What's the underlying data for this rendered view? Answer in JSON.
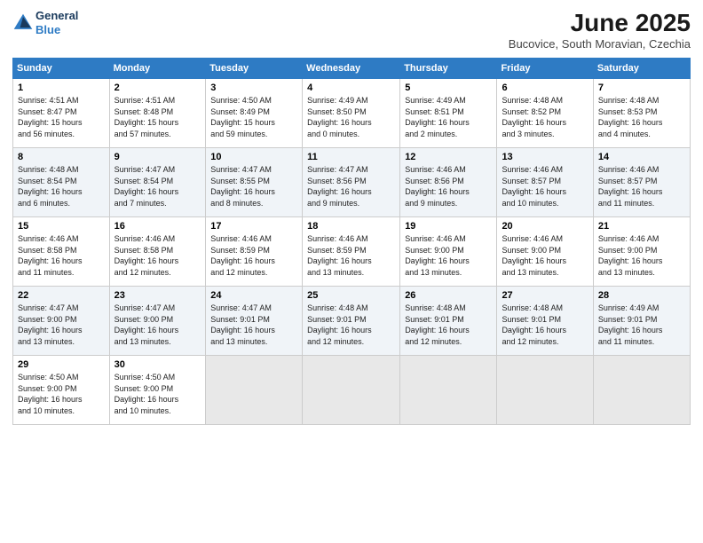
{
  "header": {
    "logo_line1": "General",
    "logo_line2": "Blue",
    "month_title": "June 2025",
    "location": "Bucovice, South Moravian, Czechia"
  },
  "weekdays": [
    "Sunday",
    "Monday",
    "Tuesday",
    "Wednesday",
    "Thursday",
    "Friday",
    "Saturday"
  ],
  "weeks": [
    [
      {
        "day": "1",
        "lines": [
          "Sunrise: 4:51 AM",
          "Sunset: 8:47 PM",
          "Daylight: 15 hours",
          "and 56 minutes."
        ]
      },
      {
        "day": "2",
        "lines": [
          "Sunrise: 4:51 AM",
          "Sunset: 8:48 PM",
          "Daylight: 15 hours",
          "and 57 minutes."
        ]
      },
      {
        "day": "3",
        "lines": [
          "Sunrise: 4:50 AM",
          "Sunset: 8:49 PM",
          "Daylight: 15 hours",
          "and 59 minutes."
        ]
      },
      {
        "day": "4",
        "lines": [
          "Sunrise: 4:49 AM",
          "Sunset: 8:50 PM",
          "Daylight: 16 hours",
          "and 0 minutes."
        ]
      },
      {
        "day": "5",
        "lines": [
          "Sunrise: 4:49 AM",
          "Sunset: 8:51 PM",
          "Daylight: 16 hours",
          "and 2 minutes."
        ]
      },
      {
        "day": "6",
        "lines": [
          "Sunrise: 4:48 AM",
          "Sunset: 8:52 PM",
          "Daylight: 16 hours",
          "and 3 minutes."
        ]
      },
      {
        "day": "7",
        "lines": [
          "Sunrise: 4:48 AM",
          "Sunset: 8:53 PM",
          "Daylight: 16 hours",
          "and 4 minutes."
        ]
      }
    ],
    [
      {
        "day": "8",
        "lines": [
          "Sunrise: 4:48 AM",
          "Sunset: 8:54 PM",
          "Daylight: 16 hours",
          "and 6 minutes."
        ]
      },
      {
        "day": "9",
        "lines": [
          "Sunrise: 4:47 AM",
          "Sunset: 8:54 PM",
          "Daylight: 16 hours",
          "and 7 minutes."
        ]
      },
      {
        "day": "10",
        "lines": [
          "Sunrise: 4:47 AM",
          "Sunset: 8:55 PM",
          "Daylight: 16 hours",
          "and 8 minutes."
        ]
      },
      {
        "day": "11",
        "lines": [
          "Sunrise: 4:47 AM",
          "Sunset: 8:56 PM",
          "Daylight: 16 hours",
          "and 9 minutes."
        ]
      },
      {
        "day": "12",
        "lines": [
          "Sunrise: 4:46 AM",
          "Sunset: 8:56 PM",
          "Daylight: 16 hours",
          "and 9 minutes."
        ]
      },
      {
        "day": "13",
        "lines": [
          "Sunrise: 4:46 AM",
          "Sunset: 8:57 PM",
          "Daylight: 16 hours",
          "and 10 minutes."
        ]
      },
      {
        "day": "14",
        "lines": [
          "Sunrise: 4:46 AM",
          "Sunset: 8:57 PM",
          "Daylight: 16 hours",
          "and 11 minutes."
        ]
      }
    ],
    [
      {
        "day": "15",
        "lines": [
          "Sunrise: 4:46 AM",
          "Sunset: 8:58 PM",
          "Daylight: 16 hours",
          "and 11 minutes."
        ]
      },
      {
        "day": "16",
        "lines": [
          "Sunrise: 4:46 AM",
          "Sunset: 8:58 PM",
          "Daylight: 16 hours",
          "and 12 minutes."
        ]
      },
      {
        "day": "17",
        "lines": [
          "Sunrise: 4:46 AM",
          "Sunset: 8:59 PM",
          "Daylight: 16 hours",
          "and 12 minutes."
        ]
      },
      {
        "day": "18",
        "lines": [
          "Sunrise: 4:46 AM",
          "Sunset: 8:59 PM",
          "Daylight: 16 hours",
          "and 13 minutes."
        ]
      },
      {
        "day": "19",
        "lines": [
          "Sunrise: 4:46 AM",
          "Sunset: 9:00 PM",
          "Daylight: 16 hours",
          "and 13 minutes."
        ]
      },
      {
        "day": "20",
        "lines": [
          "Sunrise: 4:46 AM",
          "Sunset: 9:00 PM",
          "Daylight: 16 hours",
          "and 13 minutes."
        ]
      },
      {
        "day": "21",
        "lines": [
          "Sunrise: 4:46 AM",
          "Sunset: 9:00 PM",
          "Daylight: 16 hours",
          "and 13 minutes."
        ]
      }
    ],
    [
      {
        "day": "22",
        "lines": [
          "Sunrise: 4:47 AM",
          "Sunset: 9:00 PM",
          "Daylight: 16 hours",
          "and 13 minutes."
        ]
      },
      {
        "day": "23",
        "lines": [
          "Sunrise: 4:47 AM",
          "Sunset: 9:00 PM",
          "Daylight: 16 hours",
          "and 13 minutes."
        ]
      },
      {
        "day": "24",
        "lines": [
          "Sunrise: 4:47 AM",
          "Sunset: 9:01 PM",
          "Daylight: 16 hours",
          "and 13 minutes."
        ]
      },
      {
        "day": "25",
        "lines": [
          "Sunrise: 4:48 AM",
          "Sunset: 9:01 PM",
          "Daylight: 16 hours",
          "and 12 minutes."
        ]
      },
      {
        "day": "26",
        "lines": [
          "Sunrise: 4:48 AM",
          "Sunset: 9:01 PM",
          "Daylight: 16 hours",
          "and 12 minutes."
        ]
      },
      {
        "day": "27",
        "lines": [
          "Sunrise: 4:48 AM",
          "Sunset: 9:01 PM",
          "Daylight: 16 hours",
          "and 12 minutes."
        ]
      },
      {
        "day": "28",
        "lines": [
          "Sunrise: 4:49 AM",
          "Sunset: 9:01 PM",
          "Daylight: 16 hours",
          "and 11 minutes."
        ]
      }
    ],
    [
      {
        "day": "29",
        "lines": [
          "Sunrise: 4:50 AM",
          "Sunset: 9:00 PM",
          "Daylight: 16 hours",
          "and 10 minutes."
        ]
      },
      {
        "day": "30",
        "lines": [
          "Sunrise: 4:50 AM",
          "Sunset: 9:00 PM",
          "Daylight: 16 hours",
          "and 10 minutes."
        ]
      },
      null,
      null,
      null,
      null,
      null
    ]
  ]
}
